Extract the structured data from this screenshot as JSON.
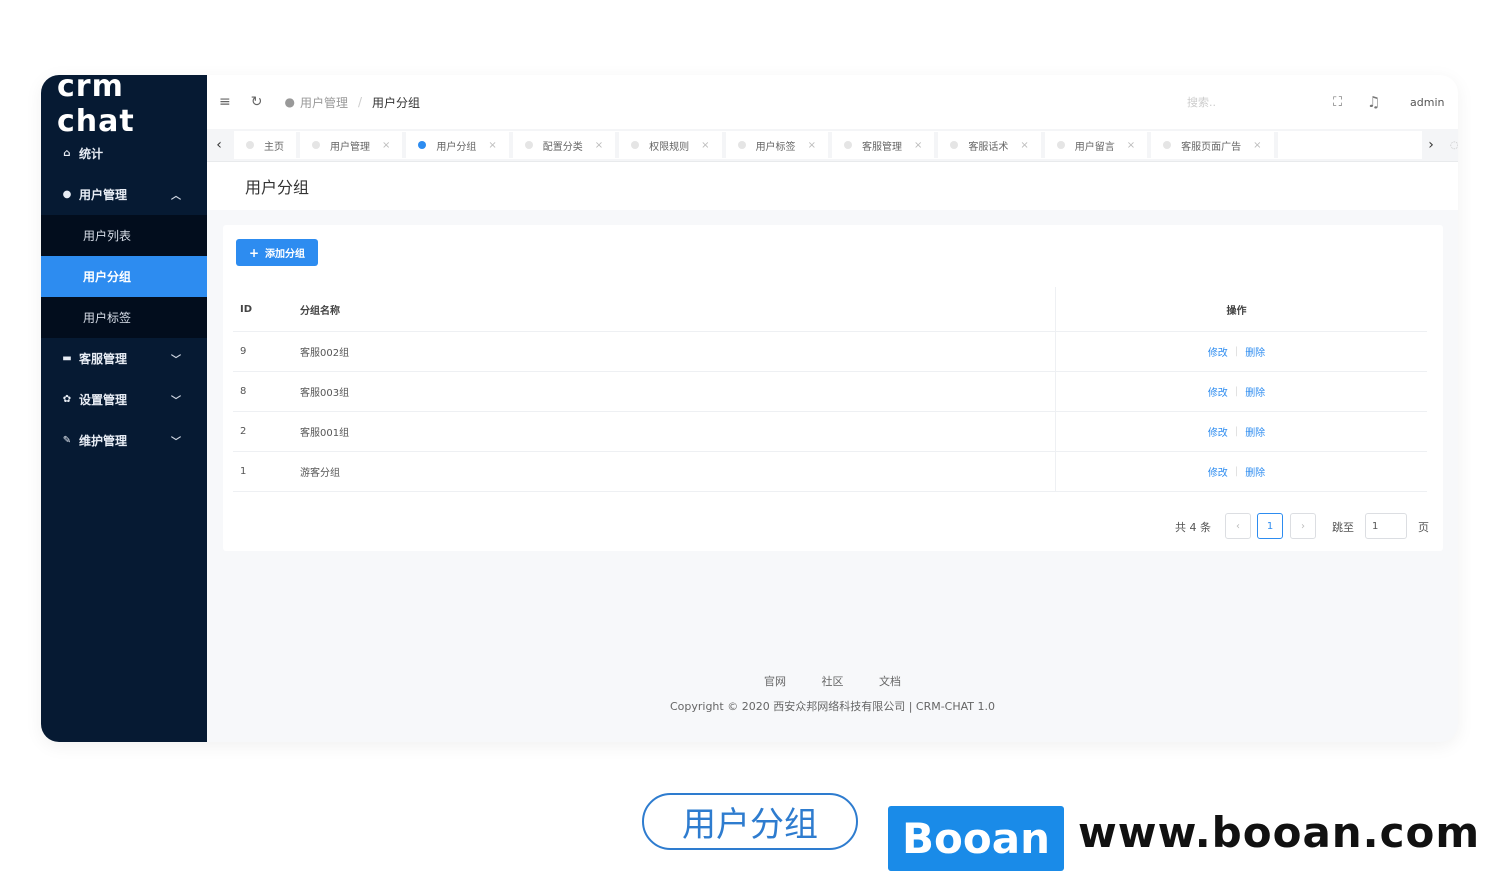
{
  "sidebar": {
    "logo": "crm chat",
    "items": [
      {
        "label": "统计",
        "icon": "home-icon"
      },
      {
        "label": "用户管理",
        "icon": "user-icon"
      },
      {
        "label": "客服管理",
        "icon": "chat-icon"
      },
      {
        "label": "设置管理",
        "icon": "gear-icon"
      },
      {
        "label": "维护管理",
        "icon": "wrench-icon"
      }
    ],
    "submenu": [
      {
        "label": "用户列表"
      },
      {
        "label": "用户分组"
      },
      {
        "label": "用户标签"
      }
    ]
  },
  "header": {
    "breadcrumb_parent": "用户管理",
    "breadcrumb_sep": "/",
    "breadcrumb_current": "用户分组",
    "search_placeholder": "搜索..",
    "user": "admin"
  },
  "tabs": [
    {
      "label": "主页"
    },
    {
      "label": "用户管理"
    },
    {
      "label": "用户分组"
    },
    {
      "label": "配置分类"
    },
    {
      "label": "权限规则"
    },
    {
      "label": "用户标签"
    },
    {
      "label": "客服管理"
    },
    {
      "label": "客服话术"
    },
    {
      "label": "用户留言"
    },
    {
      "label": "客服页面广告"
    }
  ],
  "page": {
    "title": "用户分组",
    "add_button": "添加分组"
  },
  "table": {
    "headers": {
      "id": "ID",
      "name": "分组名称",
      "op": "操作"
    },
    "op_edit": "修改",
    "op_delete": "删除",
    "rows": [
      {
        "id": "9",
        "name": "客服002组"
      },
      {
        "id": "8",
        "name": "客服003组"
      },
      {
        "id": "2",
        "name": "客服001组"
      },
      {
        "id": "1",
        "name": "游客分组"
      }
    ]
  },
  "pagination": {
    "total": "共 4 条",
    "prev": "‹",
    "current": "1",
    "next": "›",
    "jump_label": "跳至",
    "jump_value": "1",
    "page_label": "页"
  },
  "footer": {
    "links": [
      "官网",
      "社区",
      "文档"
    ],
    "copyright": "Copyright © 2020 西安众邦网络科技有限公司 | CRM-CHAT 1.0"
  },
  "caption": {
    "pill": "用户分组",
    "brand": "Booan",
    "url": "www.booan.com"
  },
  "colors": {
    "sidebar": "#061a33",
    "accent": "#2d8cf0"
  }
}
